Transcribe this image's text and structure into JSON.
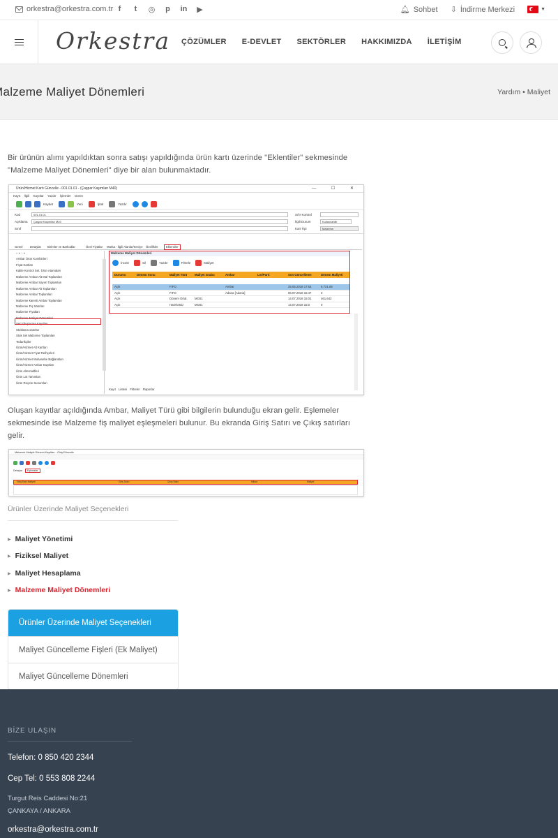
{
  "topbar": {
    "email": "orkestra@orkestra.com.tr",
    "social_icons": [
      "facebook-icon",
      "twitter-icon",
      "instagram-icon",
      "pinterest-icon",
      "linkedin-icon",
      "youtube-icon"
    ],
    "social_glyphs": [
      "f",
      "t",
      "◎",
      "p",
      "in",
      "▶"
    ],
    "chat_label": "Sohbet",
    "download_label": "İndirme Merkezi"
  },
  "header": {
    "logo": "Orkestra",
    "nav": [
      "ÇÖZÜMLER",
      "E-DEVLET",
      "SEKTÖRLER",
      "HAKKIMIZDA",
      "İLETİŞİM"
    ]
  },
  "title": {
    "heading": "Malzeme Maliyet Dönemleri",
    "breadcrumb": "Yardım • Maliyet"
  },
  "content": {
    "para1": "Bir ürünün alımı yapıldıktan sonra satışı yapıldığında ürün kartı üzerinde \"Eklentiler\" sekmesinde \"Malzeme Maliyet Dönemleri\" diye bir alan bulunmaktadır.",
    "para2": "Oluşan kayıtlar açıldığında Ambar, Maliyet Türü gibi bilgilerin bulunduğu ekran gelir. Eşlemeler sekmesinde ise Malzeme fiş maliyet eşleşmeleri bulunur. Bu ekranda Giriş Satırı ve Çıkış satırları gelir."
  },
  "screenshot1": {
    "window_title": "Ürün/Hizmet Kartı Güncelle - 001.01.01 - (Çaşpar Kaşımları M40)",
    "menu": "Kayıt İlgili Kayıtlar Yazdır İşlemler Görev",
    "toolbar": [
      "Kaydet",
      "Yeni",
      "İptal",
      "Yazdır"
    ],
    "fields": {
      "kod_label": "Kod",
      "kod_value": "001.01.01",
      "aciklama_label": "Açıklama",
      "aciklama_value": "Çaşpar Kaşımları M40",
      "sinif_label": "Sınıf",
      "kart_tipi_label": "Kart Tipi",
      "kart_tipi_value": "Malzeme",
      "sifre_label": "Sıfır Kontrol",
      "ilgili_label": "İlgili Durum",
      "ilgili_value": "Kullanılabilir"
    },
    "tabs": [
      "Genel",
      "Detaylar",
      "Birimler ve Barkodlar",
      "Özel Fiyatlar",
      "Marka - İlgili Alanlar/Seviye",
      "Özellikler",
      "Eklentiler"
    ],
    "left_items": [
      "Ambar Ürün Kombinleri",
      "Fiyat Kartları",
      "Kalite Kontrol Set. Ürün Atamaları",
      "Malzeme Ambar Alt Mal Toplamları",
      "Malzeme Ambar Sayım Toplamları",
      "Malzeme Ambar Alt Toplamları",
      "Malzeme Ambar Toplamları",
      "Malzeme karenli Ambar Toplamları",
      "Malzeme Fiş Satırları",
      "Malzeme Fiyatları",
      "Malzeme Maliyet Dönemleri",
      "Seri Oluşturma Kayıtları",
      "Stoklama satırları",
      "Stok Set Malzeme Toplamları",
      "Tedarikçiler",
      "Ürün/Hizmet Alt Kartları",
      "Ürün/Hizmet Fiyat Tarihçeleri",
      "Ürün/Hizmet Muhasebe Bağlantıları",
      "Ürün/Hizmet Ambar Kayıtları",
      "Ürün Alternatifleri",
      "Ürün Lot Tanımları",
      "Ürün Reçete Sunumları"
    ],
    "panel_title": "Malzeme Maliyet Dönemleri",
    "panel_tools": [
      "İncele",
      "Sil",
      "Yazdır",
      "Filtrele",
      "Maliyet"
    ],
    "grid_headers": [
      "Durumu",
      "Dönem Sonu",
      "Maliyet Türü",
      "Maliyet Grubu",
      "Ambar",
      "Lot/Parti",
      "Son Güncelleme",
      "Dönem Maliyeti"
    ],
    "grid_rows": [
      [
        "Açık",
        "",
        "FIFO",
        "",
        "Ambar",
        "",
        "25.06.2018 17:53",
        "5,721.65"
      ],
      [
        "Açık",
        "",
        "FIFO",
        "",
        "Adana [Adana]",
        "",
        "06.07.2018 15:47",
        "0"
      ],
      [
        "Açık",
        "",
        "Dönem Ortal.",
        "MG01",
        "",
        "",
        "14.07.2018 15:01",
        "461,642"
      ],
      [
        "Açık",
        "",
        "Hareketsiz",
        "MG01",
        "",
        "",
        "14.07.2018 15:0",
        "0"
      ]
    ],
    "bottom_tabs": [
      "Kayıt Listesi",
      "Filtreler",
      "Raporlar"
    ]
  },
  "screenshot2": {
    "window_title": "Malzeme Maliyet Dönemi Kayıtları - Giriş/Güncelle",
    "tabs": [
      "Detaylar",
      "Eşlemeler"
    ],
    "columns": [
      "Giriş/Satır Maliyeti",
      "Giriş Satırı",
      "Çıkış Satırı",
      "Miktar",
      "Maliyet"
    ]
  },
  "sidebar": {
    "label": "Ürünler Üzerinde Maliyet Seçenekleri",
    "items": [
      "Maliyet Yönetimi",
      "Fiziksel Maliyet",
      "Maliyet Hesaplama",
      "Malzeme Maliyet Dönemleri"
    ]
  },
  "box_list": {
    "title": "Ürünler Üzerinde Maliyet Seçenekleri",
    "items": [
      "Maliyet Güncelleme Fişleri (Ek Maliyet)",
      "Maliyet Güncelleme Dönemleri"
    ]
  },
  "footer": {
    "heading": "BİZE ULAŞIN",
    "phone": "Telefon: 0 850 420 2344",
    "mobile": "Cep Tel: 0 553 808 2244",
    "address1": "Turgut Reis Caddesi No:21",
    "address2": "ÇANKAYA / ANKARA",
    "email": "orkestra@orkestra.com.tr"
  },
  "colors": {
    "accent_blue": "#1ba1e2",
    "active_red": "#d9232e",
    "footer_bg": "#374250",
    "grid_header": "#f5a623"
  }
}
